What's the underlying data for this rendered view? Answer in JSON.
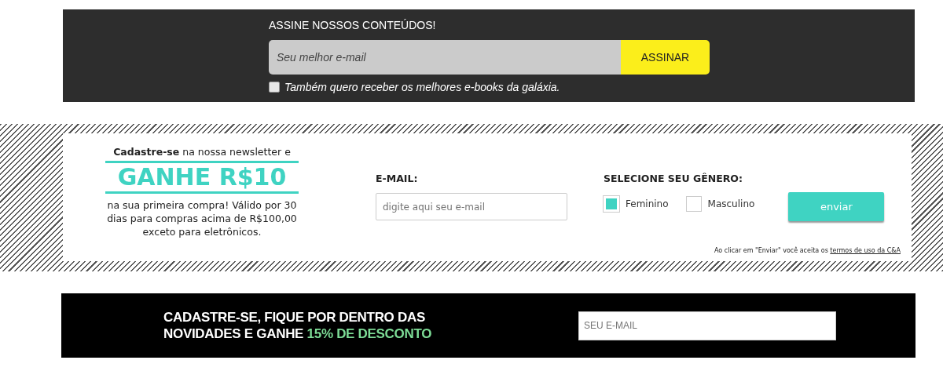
{
  "subscribe": {
    "title": "ASSINE NOSSOS CONTEÚDOS!",
    "email": {
      "placeholder": "Seu melhor e-mail"
    },
    "button": "ASSINAR",
    "ebooks": {
      "label": "Também quero receber os melhores e-books da galáxia.",
      "checked": false
    }
  },
  "newsletter": {
    "intro": "**Cadastre-se** na nossa newsletter e",
    "headline": "GANHE R$10",
    "details": "na sua primeira compra! Válido por 30 dias para compras acima de R$100,00 exceto para eletrônicos.",
    "email_label": "E-MAIL:",
    "email": {
      "placeholder": "digite aqui seu e-mail"
    },
    "gender_label": "SELECIONE SEU GÊNERO:",
    "genders": [
      {
        "label": "Feminino",
        "checked": true
      },
      {
        "label": "Masculino",
        "checked": false
      }
    ],
    "button": "enviar",
    "terms": "Ao clicar em \"Enviar\" você aceita os",
    "terms_link": "termos de uso da C&A"
  },
  "promo": {
    "heading": "CADASTRE-SE, FIQUE POR DENTRO DAS NOVIDADES E GANHE",
    "highlight": "15% DE DESCONTO",
    "email": {
      "placeholder": "SEU E-MAIL"
    }
  }
}
